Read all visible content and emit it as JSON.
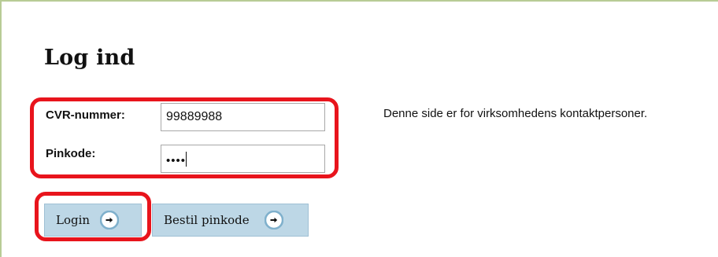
{
  "page": {
    "title": "Log ind"
  },
  "form": {
    "cvr_label": "CVR-nummer:",
    "cvr_value": "99889988",
    "pin_label": "Pinkode:",
    "pin_value": "••••"
  },
  "info": {
    "text": "Denne side er for virksomhedens kontaktpersoner."
  },
  "buttons": {
    "login_label": "Login",
    "order_pin_label": "Bestil pinkode"
  },
  "icons": {
    "login_icon": "arrow-right-icon",
    "order_icon": "arrow-right-icon"
  },
  "colors": {
    "frame_border": "#b8cc96",
    "highlight": "#e8141c",
    "button_bg": "#bdd7e6",
    "arrow_circle_ring": "#7fb0cc"
  }
}
